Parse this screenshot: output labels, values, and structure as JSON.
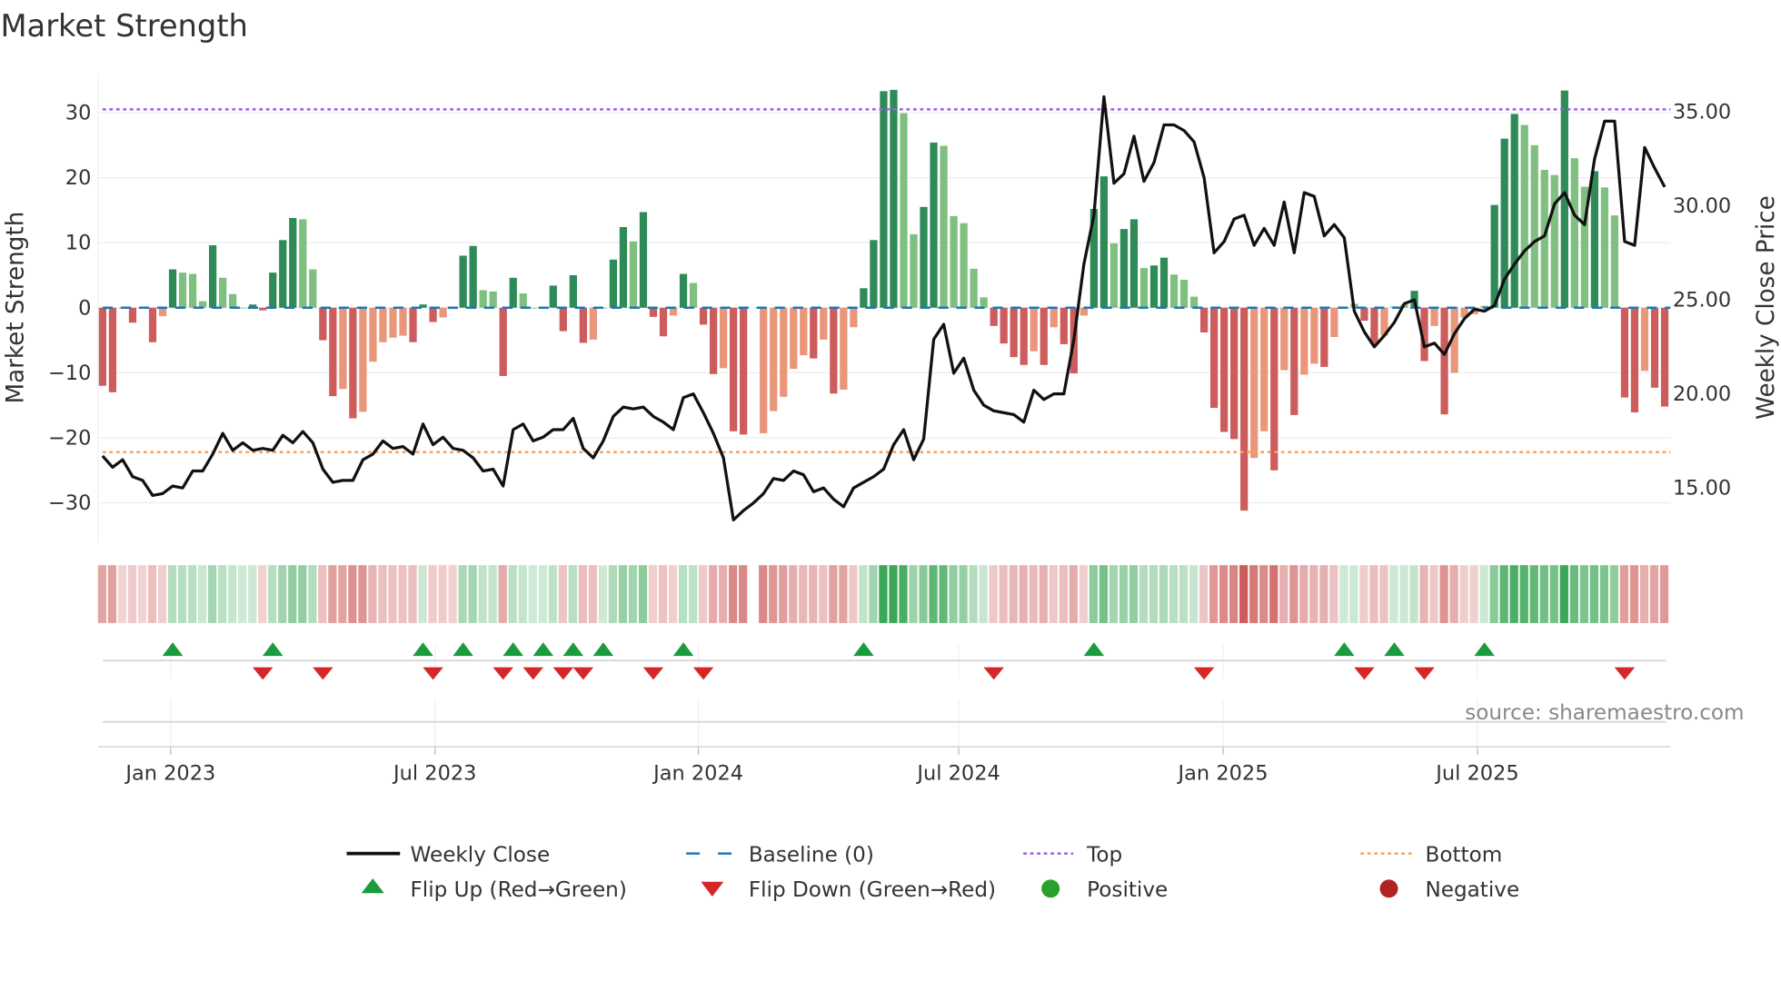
{
  "chart_data": {
    "type": "bar",
    "title": "Market Strength",
    "ylabel": "Market Strength",
    "y2label": "Weekly Close Price",
    "ylim": [
      -36.1,
      36.5
    ],
    "y2lim": [
      12.1,
      37.2
    ],
    "yticks": [
      30,
      20,
      10,
      0,
      -10,
      -20,
      -30
    ],
    "yticklabels": [
      "30",
      "20",
      "10",
      "0",
      "−10",
      "−20",
      "−30"
    ],
    "y2ticks": [
      35,
      30,
      25,
      20,
      15
    ],
    "y2ticklabels": [
      "35.00",
      "30.00",
      "25.00",
      "20.00",
      "15.00"
    ],
    "xticks_week_index": [
      6.8,
      33.2,
      59.5,
      85.5,
      111.9,
      137.3
    ],
    "xticklabels": [
      "Jan 2023",
      "Jul 2023",
      "Jan 2024",
      "Jul 2024",
      "Jan 2025",
      "Jul 2025"
    ],
    "top_level": 30.5,
    "bottom_level": -22.2,
    "baseline": 0,
    "strength": [
      -12,
      -13,
      0,
      -2.3,
      0,
      -5.3,
      -1.3,
      5.9,
      5.4,
      5.2,
      1,
      9.6,
      4.6,
      2.1,
      0,
      0.5,
      -0.4,
      5.4,
      10.4,
      13.8,
      13.6,
      5.9,
      -5,
      -13.6,
      -12.5,
      -17,
      -16,
      -8.3,
      -5.3,
      -4.6,
      -4.3,
      -5.3,
      0.5,
      -2.2,
      -1.5,
      -0.2,
      8,
      9.5,
      2.7,
      2.5,
      -10.5,
      4.6,
      2.2,
      0,
      0,
      3.4,
      -3.6,
      5,
      -5.4,
      -4.9,
      0,
      7.4,
      12.4,
      10.2,
      14.7,
      -1.4,
      -4.4,
      -1.2,
      5.2,
      3.8,
      -2.6,
      -10.2,
      -9.3,
      -19,
      -19.5,
      null,
      -19.3,
      -15.9,
      -13.7,
      -9.4,
      -7.3,
      -7.8,
      -4.9,
      -13.2,
      -12.6,
      -3,
      3,
      10.4,
      33.3,
      33.5,
      29.9,
      11.3,
      15.5,
      25.4,
      24.9,
      14.1,
      13,
      6,
      1.6,
      -2.8,
      -5.5,
      -7.6,
      -8.8,
      -6.7,
      -8.8,
      -3,
      -5.6,
      -10.1,
      -1.2,
      15.2,
      20.2,
      9.9,
      12.1,
      13.6,
      6.1,
      6.5,
      7.7,
      5.1,
      4.3,
      1.7,
      -3.8,
      -15.4,
      -19.1,
      -20.2,
      -31.2,
      -23.1,
      -19,
      -25,
      -9.6,
      -16.5,
      -10.3,
      -8.6,
      -9.1,
      -4.5,
      0,
      0.6,
      -2,
      -5.6,
      -4.3,
      0.2,
      0.5,
      2.6,
      -8.2,
      -2.8,
      -16.4,
      -10,
      -1.5,
      -1,
      0.3,
      15.8,
      26,
      29.8,
      28.1,
      25,
      21.2,
      20.4,
      33.4,
      23,
      18.6,
      21,
      18.5,
      14.2,
      -13.8,
      -16.1,
      -9.7,
      -12.3,
      -15.2
    ],
    "shade_codes": [
      "RRrRrRrGgggGgggGRGGGggRRrRrrrrrRGRrrGGggR",
      "GgggGRGRrgGGgGRRrGgRRrRRxrrrrrRrRrrGGGGg",
      "gGGgggggRRRRrRrRRrGGgGGgGGgggRRRRRrrRrRr",
      "rRrggRRrggGRrRrrrgGGGggggGggGggRRrRR"
    ],
    "weekly_close": [
      16.7,
      16.1,
      16.5,
      15.6,
      15.4,
      14.6,
      14.7,
      15.1,
      15.0,
      15.9,
      15.9,
      16.8,
      17.9,
      17.0,
      17.4,
      17.0,
      17.1,
      17.0,
      17.8,
      17.4,
      18.0,
      17.4,
      16.0,
      15.3,
      15.4,
      15.4,
      16.5,
      16.8,
      17.5,
      17.1,
      17.2,
      16.8,
      18.4,
      17.3,
      17.7,
      17.1,
      17.0,
      16.6,
      15.9,
      16.0,
      15.1,
      18.1,
      18.4,
      17.5,
      17.7,
      18.1,
      18.1,
      18.7,
      17.1,
      16.6,
      17.5,
      18.8,
      19.3,
      19.2,
      19.3,
      18.8,
      18.5,
      18.1,
      19.8,
      20.0,
      19.0,
      17.9,
      16.6,
      13.3,
      13.8,
      14.2,
      14.7,
      15.5,
      15.4,
      15.9,
      15.7,
      14.8,
      15.0,
      14.4,
      14.0,
      15.0,
      15.3,
      15.6,
      16.0,
      17.3,
      18.1,
      16.5,
      17.6,
      22.9,
      23.7,
      21.1,
      21.9,
      20.2,
      19.4,
      19.1,
      19.0,
      18.9,
      18.5,
      20.2,
      19.7,
      20.0,
      20.0,
      22.9,
      26.9,
      29.5,
      35.8,
      31.2,
      31.7,
      33.7,
      31.3,
      32.3,
      34.3,
      34.3,
      34.0,
      33.4,
      31.5,
      27.5,
      28.1,
      29.3,
      29.5,
      27.9,
      28.8,
      27.9,
      30.2,
      27.5,
      30.7,
      30.5,
      28.4,
      29.0,
      28.3,
      24.4,
      23.3,
      22.5,
      23.1,
      23.8,
      24.8,
      25.0,
      22.5,
      22.7,
      22.1,
      23.2,
      24.0,
      24.5,
      24.4,
      24.7,
      26.1,
      26.9,
      27.6,
      28.1,
      28.4,
      30.1,
      30.7,
      29.5,
      29.0,
      32.5,
      34.5,
      34.5,
      28.1,
      27.9,
      33.1,
      32.0,
      31.0
    ],
    "flip_up_week_index": [
      7,
      17,
      32,
      36,
      41,
      44,
      47,
      50,
      58,
      76,
      99,
      124,
      129,
      138
    ],
    "flip_down_week_index": [
      16,
      22,
      33,
      40,
      43,
      46,
      48,
      55,
      60,
      89,
      110,
      126,
      132,
      152
    ],
    "legend": {
      "placement": "bottom",
      "items": [
        {
          "label": "Weekly Close",
          "kind": "line"
        },
        {
          "label": "Baseline (0)",
          "kind": "dash"
        },
        {
          "label": "Top",
          "kind": "dot-purple"
        },
        {
          "label": "Bottom",
          "kind": "dot-orange"
        },
        {
          "label": "Flip Up (Red→Green)",
          "kind": "tri-up"
        },
        {
          "label": "Flip Down (Green→Red)",
          "kind": "tri-down"
        },
        {
          "label": "Positive",
          "kind": "circle-green"
        },
        {
          "label": "Negative",
          "kind": "circle-red"
        }
      ]
    },
    "annotation": "source: sharemaestro.com",
    "colors": {
      "strong_pos": "#2e8b57",
      "weak_pos": "#7fbf7f",
      "strong_neg": "#cd5c5c",
      "weak_neg": "#e9967a",
      "close": "#111111",
      "baseline": "#1f77b4",
      "top": "#9b5de5",
      "bottom": "#f4a261",
      "flip_up": "#1a9c3e",
      "flip_down": "#d62728",
      "positive": "#2ca02c",
      "negative": "#b22222"
    }
  }
}
